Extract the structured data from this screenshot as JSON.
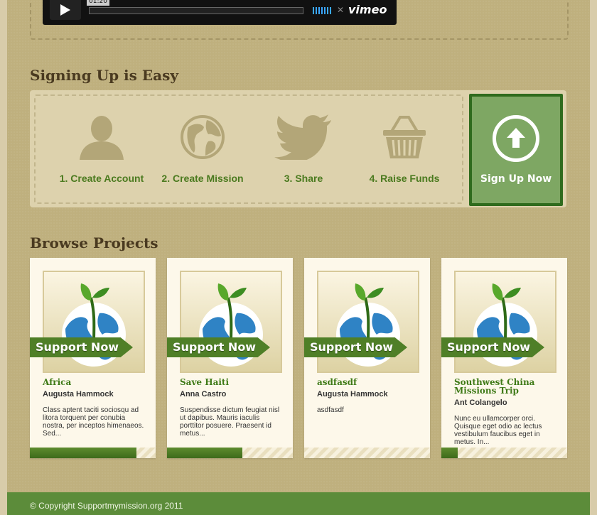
{
  "video": {
    "time": "01:20",
    "brand": "vimeo"
  },
  "signup": {
    "title": "Signing Up is Easy",
    "steps": [
      {
        "label": "1. Create Account",
        "icon": "user-icon"
      },
      {
        "label": "2. Create Mission",
        "icon": "globe-icon"
      },
      {
        "label": "3. Share",
        "icon": "twitter-bird-icon"
      },
      {
        "label": "4. Raise Funds",
        "icon": "basket-icon"
      }
    ],
    "button_label": "Sign Up Now"
  },
  "browse": {
    "title": "Browse Projects",
    "support_label": "Support Now",
    "projects": [
      {
        "title": "Africa",
        "author": "Augusta Hammock",
        "description": "Class aptent taciti sociosqu ad litora torquent per conubia nostra, per inceptos himenaeos. Sed...",
        "progress": 0.85
      },
      {
        "title": "Save Haiti",
        "author": "Anna Castro",
        "description": "Suspendisse dictum feugiat nisl ut dapibus. Mauris iaculis porttitor posuere. Praesent id metus...",
        "progress": 0.6
      },
      {
        "title": "asdfasdf",
        "author": "Augusta Hammock",
        "description": "asdfasdf",
        "progress": 0.0
      },
      {
        "title": "Southwest China Missions Trip",
        "author": "Ant Colangelo",
        "description": "Nunc eu ullamcorper orci. Quisque eget odio ac lectus vestibulum faucibus eget in metus. In...",
        "progress": 0.13
      }
    ]
  },
  "footer": {
    "copyright": "© Copyright Supportmymission.org 2011"
  },
  "colors": {
    "accent_green": "#4f7f27",
    "page_bg": "#bfb07e",
    "footer_green": "#5c8c3a"
  }
}
